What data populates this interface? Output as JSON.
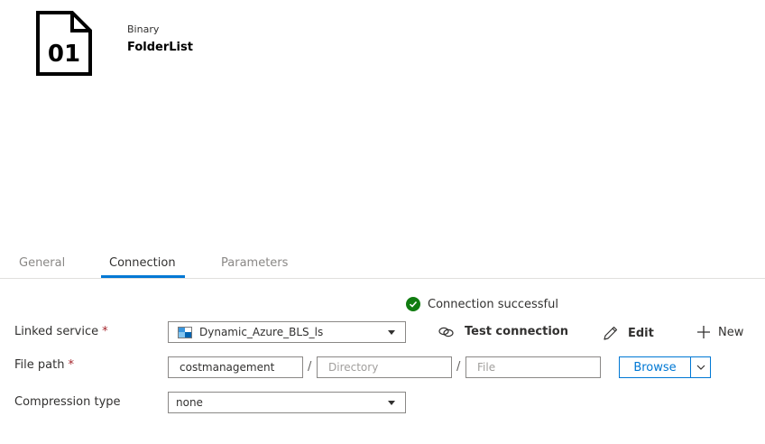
{
  "dataset": {
    "icon_text": "01",
    "type": "Binary",
    "name": "FolderList"
  },
  "tabs": [
    {
      "label": "General",
      "active": false
    },
    {
      "label": "Connection",
      "active": true
    },
    {
      "label": "Parameters",
      "active": false
    }
  ],
  "connection_status": {
    "text": "Connection successful",
    "color": "#107c10"
  },
  "linked_service": {
    "label": "Linked service",
    "required_mark": "*",
    "value": "Dynamic_Azure_BLS_ls",
    "test_connection_label": "Test connection",
    "edit_label": "Edit",
    "new_label": "New"
  },
  "file_path": {
    "label": "File path",
    "required_mark": "*",
    "container_value": "costmanagement",
    "directory_placeholder": "Directory",
    "file_placeholder": "File",
    "separator": "/",
    "browse_label": "Browse"
  },
  "compression": {
    "label": "Compression type",
    "value": "none"
  },
  "colors": {
    "accent": "#0078d4",
    "required": "#a4262c",
    "success": "#107c10"
  }
}
